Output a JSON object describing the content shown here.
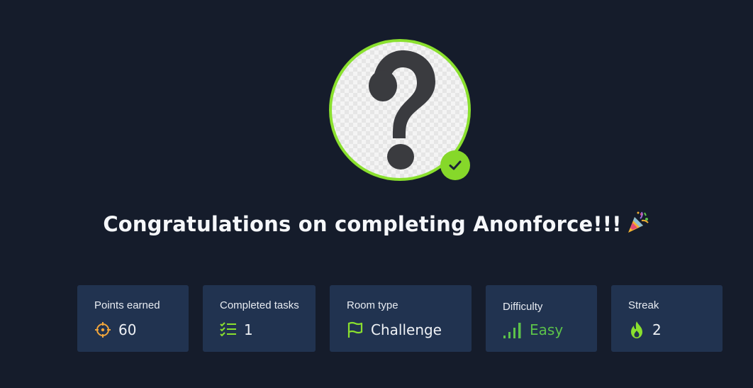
{
  "avatar": {
    "icon": "question-mark-avatar",
    "badge_icon": "check-icon",
    "accent_color": "#8ae02e"
  },
  "headline": {
    "text": "Congratulations on completing Anonforce!!!",
    "emoji_icon": "party-popper-icon"
  },
  "stats": {
    "points": {
      "label": "Points earned",
      "value": "60",
      "icon": "target-icon",
      "icon_color": "#f0a53b"
    },
    "tasks": {
      "label": "Completed tasks",
      "value": "1",
      "icon": "checklist-icon",
      "icon_color": "#8ae02e"
    },
    "room_type": {
      "label": "Room type",
      "value": "Challenge",
      "icon": "flag-icon",
      "icon_color": "#8ae02e"
    },
    "difficulty": {
      "label": "Difficulty",
      "value": "Easy",
      "icon": "signal-bars-icon",
      "color": "#5cc24a"
    },
    "streak": {
      "label": "Streak",
      "value": "2",
      "icon": "flame-icon",
      "icon_color": "#8ae02e"
    }
  }
}
